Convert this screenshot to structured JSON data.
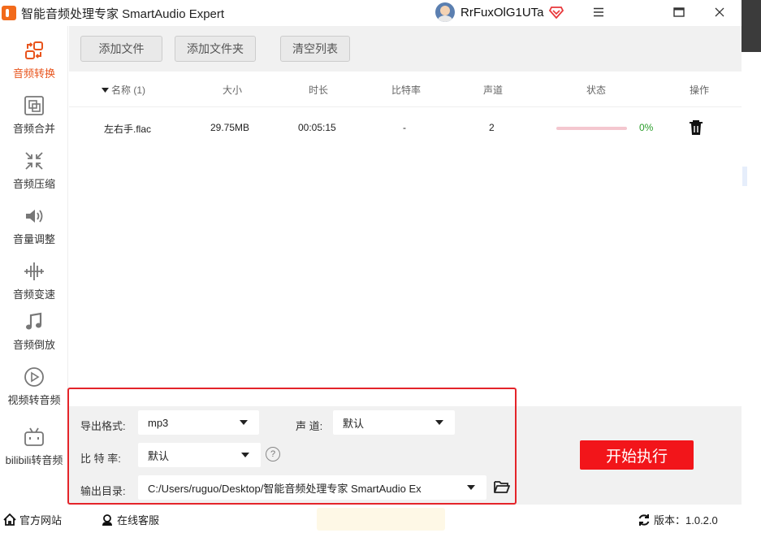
{
  "window": {
    "title": "智能音频处理专家 SmartAudio Expert",
    "username": "RrFuxOlG1UTa",
    "controls": {
      "menu": "≡",
      "maximize": "☐",
      "close": "✕"
    }
  },
  "sidebar": {
    "items": [
      {
        "label": "音频转换",
        "icon": "convert-icon",
        "active": true
      },
      {
        "label": "音频合并",
        "icon": "merge-icon",
        "active": false
      },
      {
        "label": "音频压缩",
        "icon": "compress-icon",
        "active": false
      },
      {
        "label": "音量调整",
        "icon": "volume-icon",
        "active": false
      },
      {
        "label": "音频变速",
        "icon": "speed-icon",
        "active": false
      },
      {
        "label": "音频倒放",
        "icon": "music-note-icon",
        "active": false
      },
      {
        "label": "视频转音频",
        "icon": "play-icon",
        "active": false
      },
      {
        "label": "bilibili转音频",
        "icon": "bilibili-icon",
        "active": false
      }
    ],
    "accent": "#e8541c"
  },
  "toolbar": {
    "add_file": "添加文件",
    "add_folder": "添加文件夹",
    "clear_list": "清空列表"
  },
  "table": {
    "columns": {
      "name": "名称 (1)",
      "size": "大小",
      "duration": "时长",
      "bitrate": "比特率",
      "channel": "声道",
      "status": "状态",
      "action": "操作"
    },
    "rows": [
      {
        "name": "左右手.flac",
        "size": "29.75MB",
        "duration": "00:05:15",
        "bitrate": "-",
        "channel": "2",
        "progress": 0,
        "status": "0%"
      }
    ]
  },
  "settings": {
    "format_label": "导出格式:",
    "format_value": "mp3",
    "channel_label": "声 道:",
    "channel_value": "默认",
    "bitrate_label": "比 特 率:",
    "bitrate_value": "默认",
    "help": "?",
    "output_label": "输出目录:",
    "output_value": "C:/Users/ruguo/Desktop/智能音频处理专家 SmartAudio Ex"
  },
  "start_button": "开始执行",
  "statusbar": {
    "website": "官方网站",
    "support": "在线客服",
    "version": "版本：1.0.2.0"
  },
  "colors": {
    "start_button": "#f2151a",
    "highlight_box": "#e4242a",
    "progress_track": "#f4c7cf",
    "status_text": "#2a9d2a"
  }
}
